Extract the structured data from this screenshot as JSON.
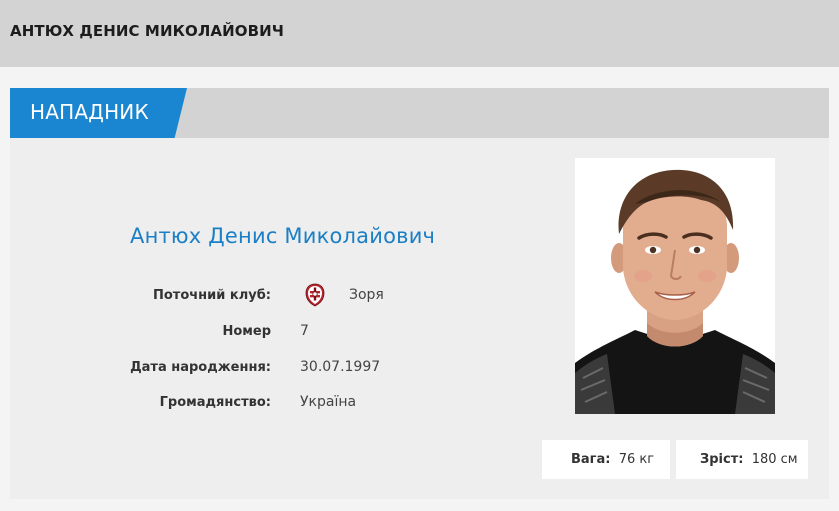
{
  "header": {
    "title": "АНТЮХ ДЕНИС МИКОЛАЙОВИЧ"
  },
  "card": {
    "position_label": "НАПАДНИК",
    "player_name": "Антюх Денис Миколайович",
    "info": {
      "club_label": "Поточний клуб:",
      "club_value": "Зоря",
      "club_logo_icon": "zorya-club-crest-icon",
      "number_label": "Номер",
      "number_value": "7",
      "birth_label": "Дата народження:",
      "birth_value": "30.07.1997",
      "citizenship_label": "Громадянство:",
      "citizenship_value": "Україна"
    },
    "stats": {
      "weight_label": "Вага:",
      "weight_value": "76 кг",
      "height_label": "Зріст:",
      "height_value": "180 см"
    }
  },
  "colors": {
    "accent_blue": "#1a85d0",
    "name_blue": "#1a7fc4",
    "header_gray": "#d3d3d3",
    "card_gray": "#eeeeee"
  }
}
